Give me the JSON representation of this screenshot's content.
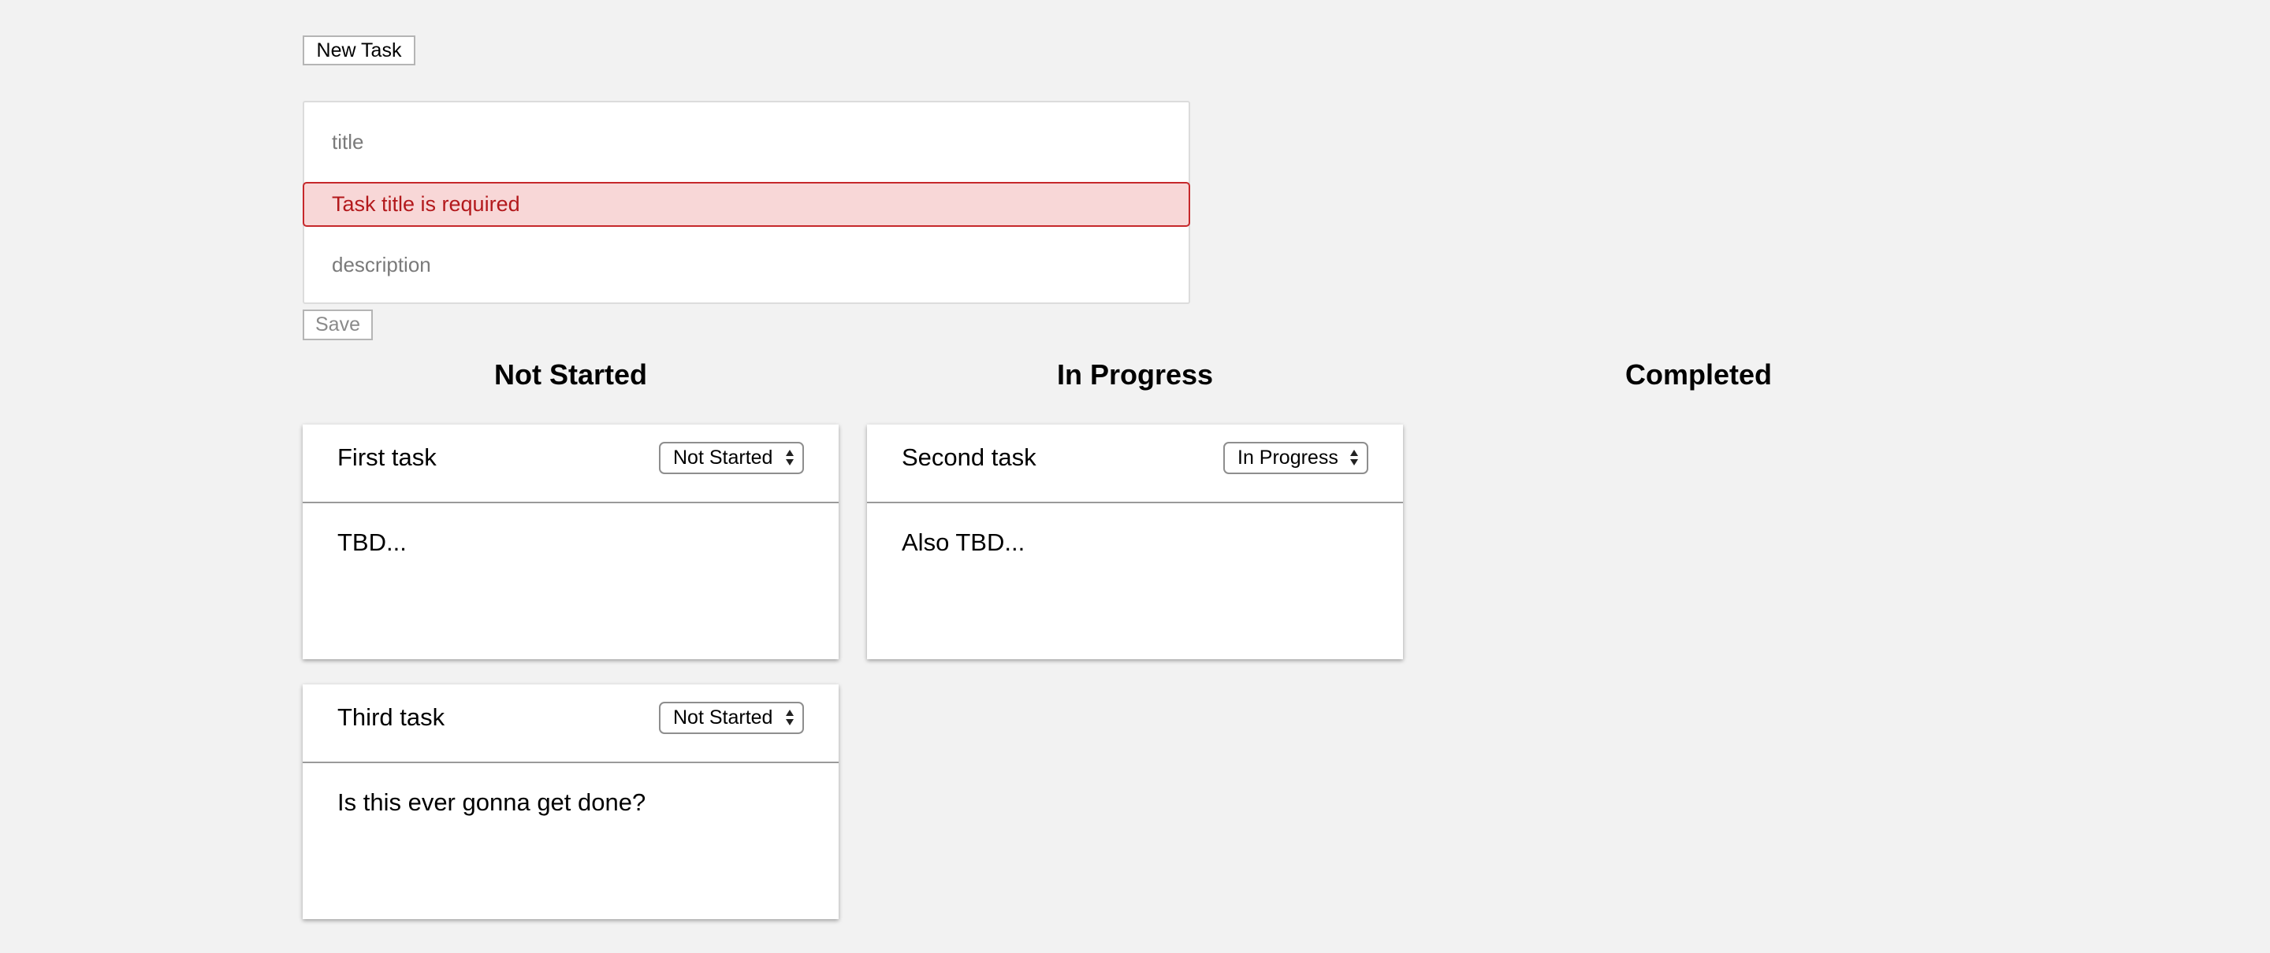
{
  "toolbar": {
    "new_task_label": "New Task"
  },
  "form": {
    "title_placeholder": "title",
    "error_message": "Task title is required",
    "description_placeholder": "description",
    "save_label": "Save"
  },
  "columns": [
    {
      "heading": "Not Started"
    },
    {
      "heading": "In Progress"
    },
    {
      "heading": "Completed"
    }
  ],
  "tasks": [
    {
      "title": "First task",
      "status": "Not Started",
      "description": "TBD..."
    },
    {
      "title": "Second task",
      "status": "In Progress",
      "description": "Also TBD..."
    },
    {
      "title": "Third task",
      "status": "Not Started",
      "description": "Is this ever gonna get done?"
    }
  ],
  "colors": {
    "background": "#f2f2f2",
    "error_background": "#f8d7d7",
    "error_border": "#c6282b",
    "error_text": "#b3191c"
  }
}
